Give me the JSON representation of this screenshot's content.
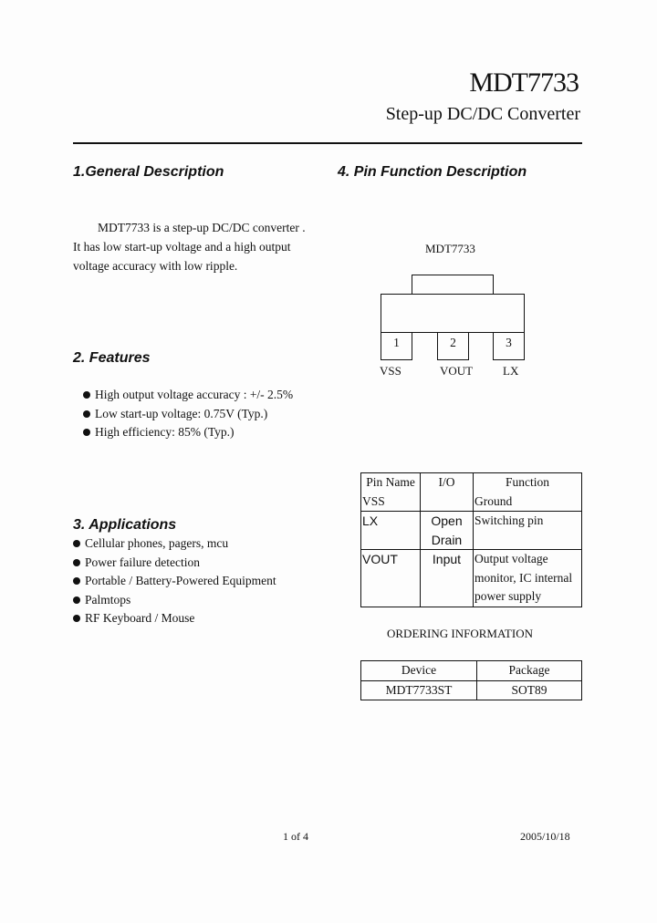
{
  "header": {
    "title": "MDT7733",
    "subtitle": "Step-up DC/DC Converter"
  },
  "sections": {
    "general": {
      "heading": "1.General Description",
      "lines": [
        "MDT7733 is a step-up DC/DC converter .",
        "It has low start-up voltage and a high output",
        "voltage accuracy with low ripple."
      ]
    },
    "features": {
      "heading": "2. Features",
      "items": [
        "High output voltage accuracy : +/- 2.5%",
        "Low start-up voltage: 0.75V (Typ.)",
        "High efficiency: 85% (Typ.)"
      ]
    },
    "applications": {
      "heading": "3. Applications",
      "items": [
        "Cellular phones, pagers, mcu",
        "Power failure detection",
        "Portable / Battery-Powered Equipment",
        "Palmtops",
        "RF Keyboard / Mouse"
      ]
    },
    "pins": {
      "heading": "4. Pin Function Description",
      "diagram_label": "MDT7733",
      "pins": [
        {
          "number": "1",
          "name": "VSS"
        },
        {
          "number": "2",
          "name": "VOUT"
        },
        {
          "number": "3",
          "name": "LX"
        }
      ],
      "table": {
        "headers": [
          "Pin Name",
          "I/O",
          "Function"
        ],
        "rows": [
          {
            "pin": "VSS",
            "io": "",
            "function": "Ground"
          },
          {
            "pin": "LX",
            "io": "Open Drain",
            "io_lines": [
              "Open",
              "Drain"
            ],
            "function": "Switching pin"
          },
          {
            "pin": "VOUT",
            "io": "Input",
            "function_lines": [
              "Output voltage",
              "monitor, IC internal",
              "power supply"
            ]
          }
        ]
      }
    },
    "ordering": {
      "heading": "ORDERING INFORMATION",
      "headers": [
        "Device",
        "Package"
      ],
      "rows": [
        {
          "device": "MDT7733ST",
          "package": "SOT89"
        }
      ]
    }
  },
  "footer": {
    "page": "1 of 4",
    "date": "2005/10/18"
  }
}
